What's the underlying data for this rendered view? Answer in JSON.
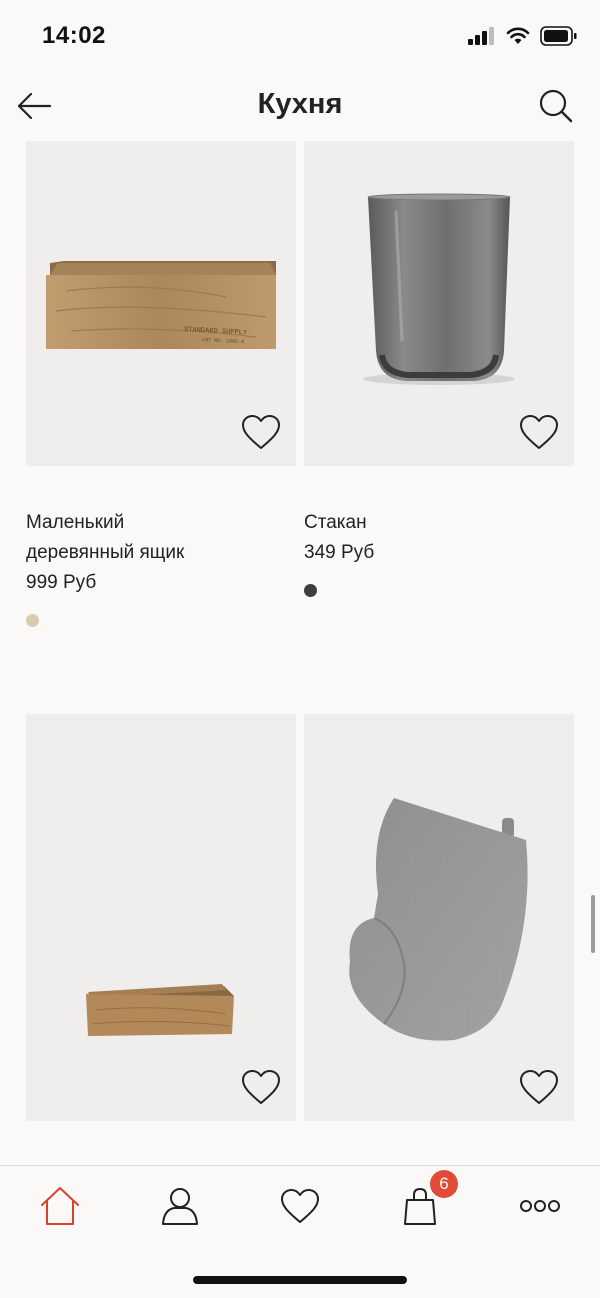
{
  "status_bar": {
    "time": "14:02"
  },
  "header": {
    "title": "Кухня"
  },
  "products": [
    {
      "name": "Маленький деревянный ящик",
      "name_line1": "Маленький",
      "name_line2": "деревянный ящик",
      "price": "999 Руб",
      "swatch_color": "#d9ccb0",
      "image": "wooden-box-long"
    },
    {
      "name": "Стакан",
      "price": "349 Руб",
      "swatch_color": "#3e3e3e",
      "image": "smoked-glass"
    },
    {
      "image": "wooden-tray-small"
    },
    {
      "image": "grey-oven-mitt"
    }
  ],
  "tab_bar": {
    "items": [
      "home-icon",
      "profile-icon",
      "favorites-icon",
      "bag-icon",
      "more-icon"
    ],
    "cart_count": "6",
    "accent_color": "#d9402f"
  }
}
